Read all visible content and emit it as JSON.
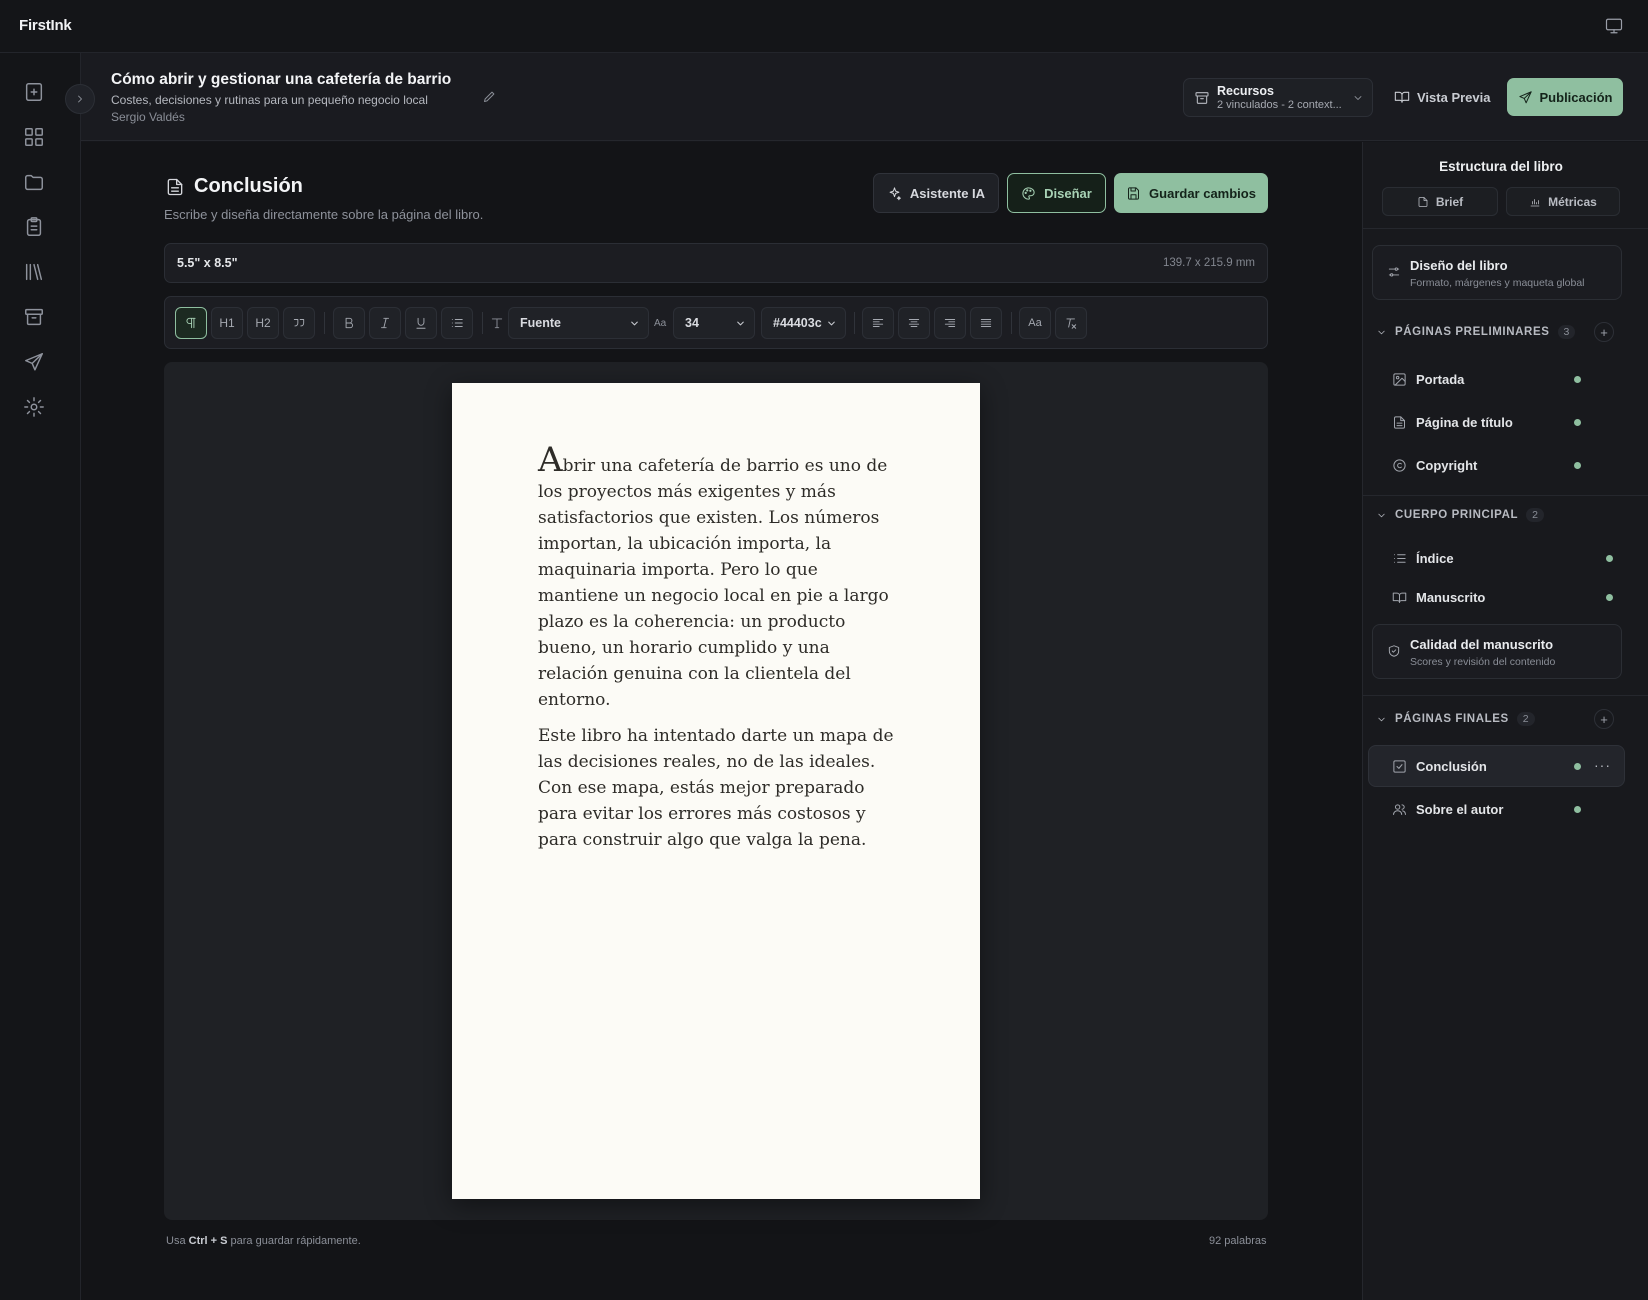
{
  "app": {
    "brand": "FirstInk"
  },
  "book": {
    "title": "Cómo abrir y gestionar una cafetería de barrio",
    "subtitle": "Costes, decisiones y rutinas para un pequeño negocio local",
    "author": "Sergio Valdés"
  },
  "header": {
    "resources_title": "Recursos",
    "resources_sub": "2 vinculados - 2 context...",
    "preview_label": "Vista Previa",
    "publish_label": "Publicación"
  },
  "editor": {
    "page_title": "Conclusión",
    "page_desc": "Escribe y diseña directamente sobre la página del libro.",
    "ai_label": "Asistente IA",
    "design_label": "Diseñar",
    "save_label": "Guardar cambios",
    "trim_size": "5.5\" x 8.5\"",
    "trim_mm": "139.7 x 215.9 mm",
    "toolbar": {
      "h1": "H1",
      "h2": "H2",
      "font_select": "Fuente",
      "size_label": "Aa",
      "size_value": "34",
      "color_value": "#44403c",
      "case_label": "Aa"
    },
    "content": {
      "dropcap": "A",
      "p1_rest": "brir una cafetería de barrio es uno de los proyectos más exigentes y más satisfactorios que existen. Los números importan, la ubicación importa, la maquinaria importa. Pero lo que mantiene un negocio local en pie a largo plazo es la coherencia: un producto bueno, un horario cumplido y una relación genuina con la clientela del entorno.",
      "p2": "Este libro ha intentado darte un mapa de las decisiones reales, no de las ideales. Con ese mapa, estás mejor preparado para evitar los errores más costosos y para construir algo que valga la pena."
    },
    "footer": {
      "hint_pre": "Usa",
      "hint_keys": "Ctrl + S",
      "hint_post": "para guardar rápidamente.",
      "word_count": "92 palabras"
    }
  },
  "panel": {
    "title": "Estructura del libro",
    "tabs": [
      "Brief",
      "Métricas"
    ],
    "design_card": {
      "title": "Diseño del libro",
      "sub": "Formato, márgenes y maqueta global"
    },
    "sections": [
      {
        "label": "PÁGINAS PRELIMINARES",
        "count": "3",
        "items": [
          "Portada",
          "Página de título",
          "Copyright"
        ]
      },
      {
        "label": "CUERPO PRINCIPAL",
        "count": "2",
        "items": [
          "Índice",
          "Manuscrito"
        ]
      },
      {
        "label": "PÁGINAS FINALES",
        "count": "2",
        "items": [
          "Conclusión",
          "Sobre el autor"
        ]
      }
    ],
    "quality_card": {
      "title": "Calidad del manuscrito",
      "sub": "Scores y revisión del contenido"
    }
  },
  "colors": {
    "accent": "#8fbfa0",
    "paper": "#fcfbf6",
    "text_on_paper": "#44403c"
  }
}
